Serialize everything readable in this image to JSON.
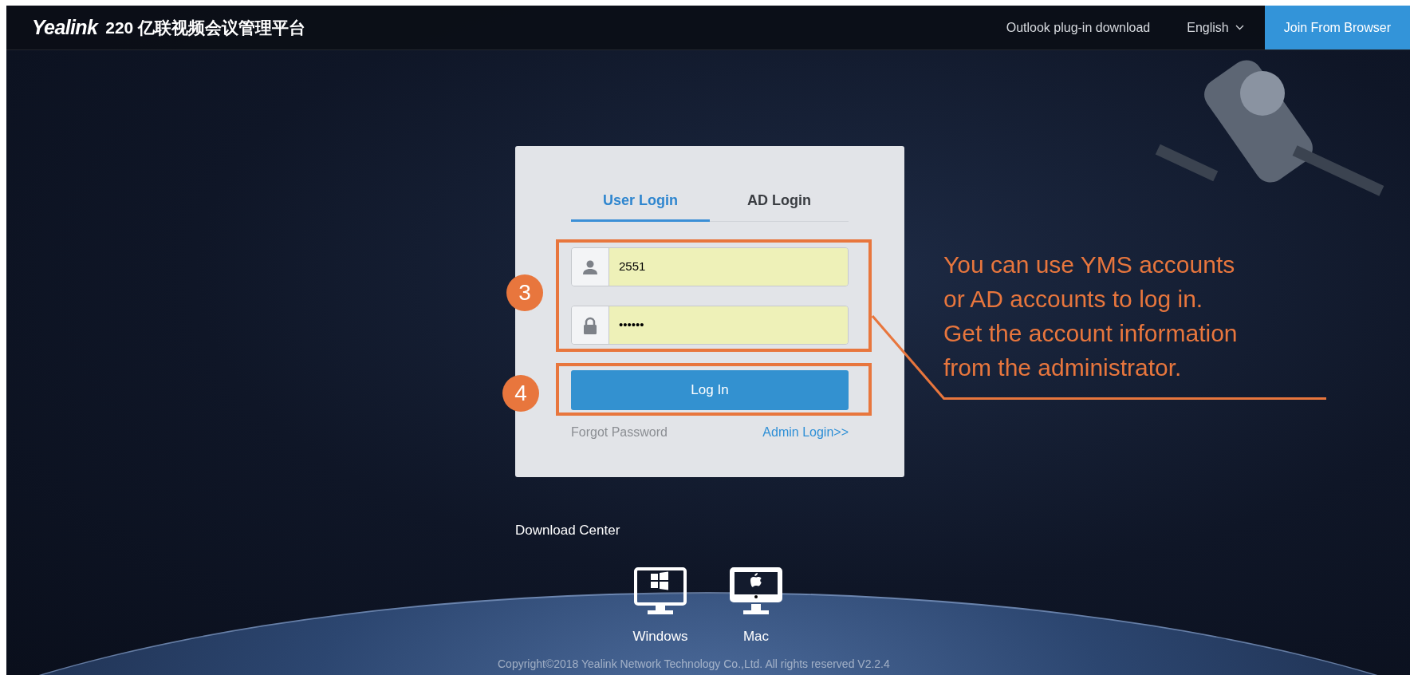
{
  "header": {
    "logo": "Yealink",
    "title": "220 亿联视频会议管理平台",
    "outlook_link": "Outlook plug-in download",
    "language": "English",
    "join_button": "Join From Browser"
  },
  "login": {
    "tabs": [
      {
        "label": "User Login",
        "selected": true
      },
      {
        "label": "AD Login",
        "selected": false
      }
    ],
    "fields": [
      {
        "kind": "user",
        "value": "2551"
      },
      {
        "kind": "password",
        "value": "••••••"
      }
    ],
    "login_button": "Log In",
    "forgot_link": "Forgot Password",
    "admin_link": "Admin Login>>"
  },
  "annotations": {
    "markers": [
      "3",
      "4"
    ],
    "callout": [
      "You can use YMS accounts",
      "or AD accounts to log in.",
      "Get the account information",
      "from the administrator."
    ]
  },
  "downloads": {
    "title": "Download Center",
    "items": [
      {
        "kind": "windows",
        "label": "Windows"
      },
      {
        "kind": "mac",
        "label": "Mac"
      }
    ]
  },
  "copyright": "Copyright©2018 Yealink Network Technology Co.,Ltd. All rights reserved V2.2.4"
}
